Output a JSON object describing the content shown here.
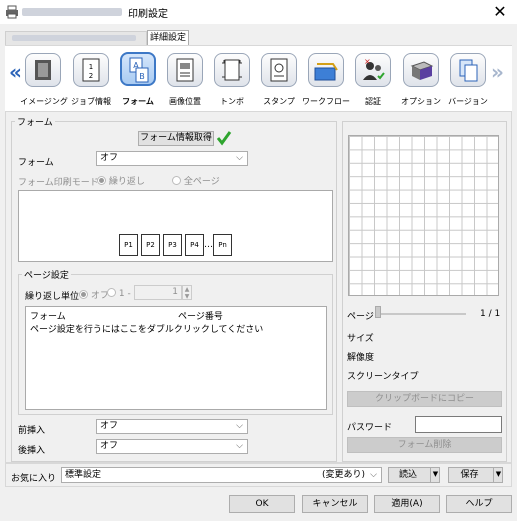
{
  "window": {
    "title": "印刷設定",
    "close_glyph": "✕"
  },
  "tabs": {
    "detail": "詳細設定"
  },
  "toolbar": {
    "items": [
      {
        "label": "イメージング",
        "icon": "imaging-icon"
      },
      {
        "label": "ジョブ情報",
        "icon": "job-info-icon"
      },
      {
        "label": "フォーム",
        "icon": "form-icon",
        "selected": true
      },
      {
        "label": "画像位置",
        "icon": "image-position-icon"
      },
      {
        "label": "トンボ",
        "icon": "crop-marks-icon"
      },
      {
        "label": "スタンプ",
        "icon": "stamp-icon"
      },
      {
        "label": "ワークフロー",
        "icon": "workflow-icon"
      },
      {
        "label": "認証",
        "icon": "authentication-icon"
      },
      {
        "label": "オプション",
        "icon": "options-icon"
      },
      {
        "label": "バージョン",
        "icon": "version-icon"
      }
    ],
    "left_arrow": "«",
    "right_arrow": "»"
  },
  "form_group": {
    "title": "フォーム",
    "get_info_button": "フォーム情報取得",
    "form_label": "フォーム",
    "form_value": "オフ",
    "print_mode_label": "フォーム印刷モード",
    "mode_repeat": "繰り返し",
    "mode_all_pages": "全ページ",
    "pages": [
      "P1",
      "P2",
      "P3",
      "P4",
      "…",
      "Pn"
    ]
  },
  "page_settings": {
    "title": "ページ設定",
    "repeat_unit_label": "繰り返し単位",
    "off_option": "オフ",
    "num_option": "1 -",
    "spin_value": "1",
    "col_form": "フォーム",
    "col_page_no": "ページ番号",
    "hint": "ページ設定を行うにはここをダブルクリックしてください"
  },
  "front_insert": {
    "label": "前挿入",
    "value": "オフ"
  },
  "back_insert": {
    "label": "後挿入",
    "value": "オフ"
  },
  "preview": {
    "page_label": "ページ",
    "page_count": "1 / 1",
    "size_label": "サイズ",
    "resolution_label": "解像度",
    "screen_type_label": "スクリーンタイプ",
    "copy_button": "クリップボードにコピー",
    "password_label": "パスワード",
    "delete_button": "フォーム削除"
  },
  "favorites": {
    "label": "お気に入り",
    "value": "標準設定",
    "changed": "(変更あり)",
    "load_button": "読込",
    "save_button": "保存"
  },
  "footer": {
    "ok": "OK",
    "cancel": "キャンセル",
    "apply": "適用(A)",
    "help": "ヘルプ"
  },
  "colors": {
    "accent": "#2b63b8",
    "check": "#2fa52f"
  }
}
